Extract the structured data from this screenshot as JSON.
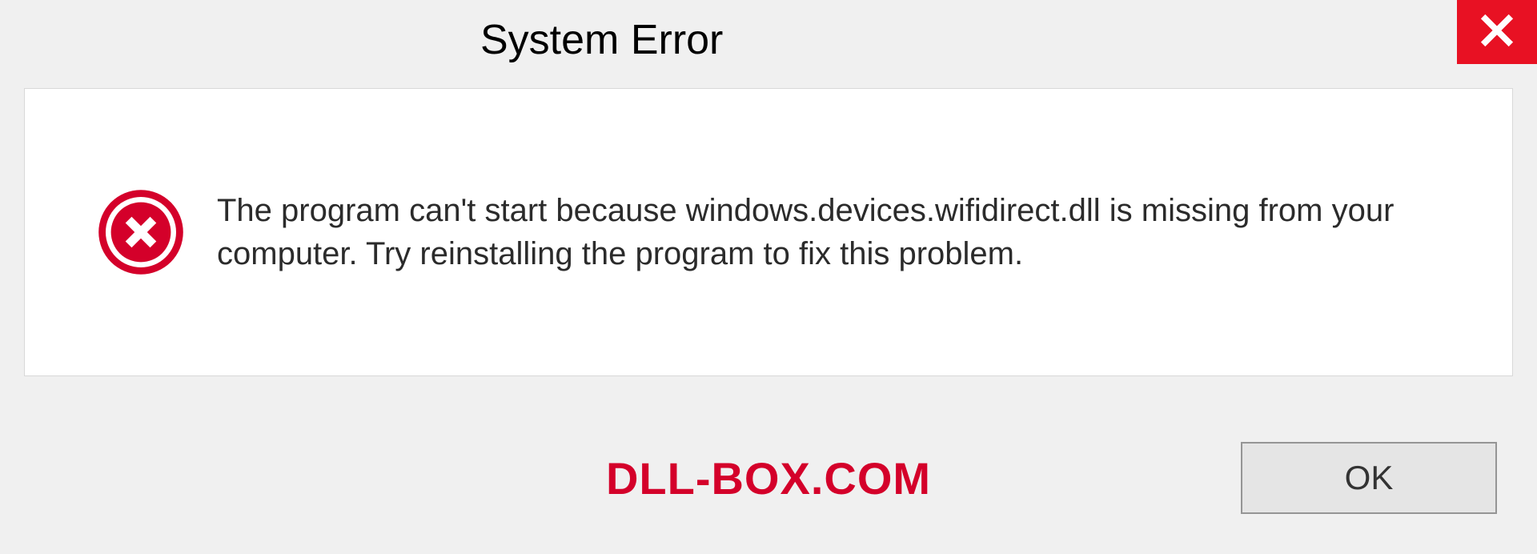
{
  "dialog": {
    "title": "System Error",
    "message": "The program can't start because windows.devices.wifidirect.dll is missing from your computer. Try reinstalling the program to fix this problem.",
    "ok_label": "OK"
  },
  "watermark": "DLL-BOX.COM",
  "colors": {
    "close_bg": "#e81123",
    "error_icon": "#d4002a",
    "watermark": "#d4002a"
  }
}
